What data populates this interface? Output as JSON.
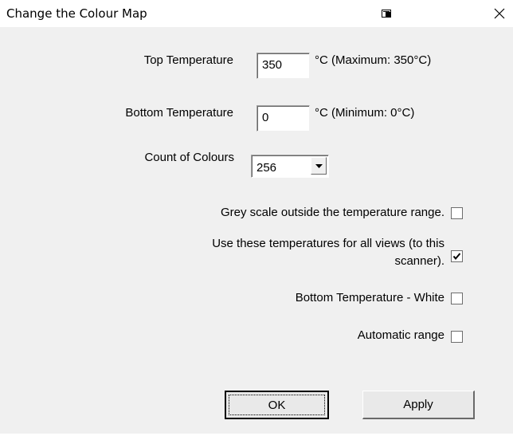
{
  "window": {
    "title": "Change the Colour Map",
    "restore_icon": "window-snap-icon",
    "close_icon": "close-icon",
    "close_glyph": "✕"
  },
  "top_temperature": {
    "label": "Top Temperature",
    "value": "350",
    "hint": "°C (Maximum: 350°C)"
  },
  "bottom_temperature": {
    "label": "Bottom Temperature",
    "value": "0",
    "hint": "°C (Minimum: 0°C)"
  },
  "count_of_colours": {
    "label": "Count of Colours",
    "selected": "256"
  },
  "options": {
    "grey_scale": {
      "label": "Grey scale outside the temperature range.",
      "checked": false
    },
    "use_for_all_line1": "Use these temperatures for all views (to this",
    "use_for_all_line2": "scanner).",
    "use_for_all_checked": true,
    "bottom_white": {
      "label": "Bottom Temperature - White",
      "checked": false
    },
    "automatic_range": {
      "label": "Automatic range",
      "checked": false
    }
  },
  "buttons": {
    "ok": "OK",
    "apply": "Apply"
  }
}
